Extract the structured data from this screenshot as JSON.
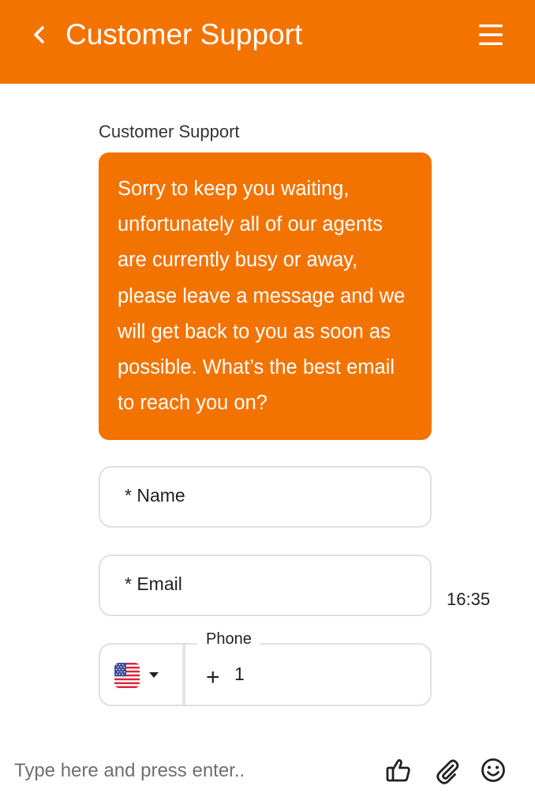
{
  "header": {
    "title": "Customer Support",
    "back_icon": "chevron-left-icon",
    "menu_icon": "hamburger-menu-icon",
    "background_color": "#f37300"
  },
  "chat": {
    "sender": "Customer Support",
    "message": "Sorry to keep you waiting, unfortunately all of our agents are currently busy or away, please leave a message and we will get back to you as soon as possible. What’s the best email to reach you on?",
    "bubble_color": "#f37300",
    "timestamp": "16:35"
  },
  "form": {
    "name_placeholder": "* Name",
    "email_placeholder": "* Email",
    "phone": {
      "label": "Phone",
      "country_flag": "us-flag-icon",
      "plus": "+",
      "dial_code": "1"
    }
  },
  "composer": {
    "placeholder": "Type here and press enter..",
    "icons": [
      "thumbs-up-icon",
      "paperclip-icon",
      "emoji-icon"
    ]
  }
}
